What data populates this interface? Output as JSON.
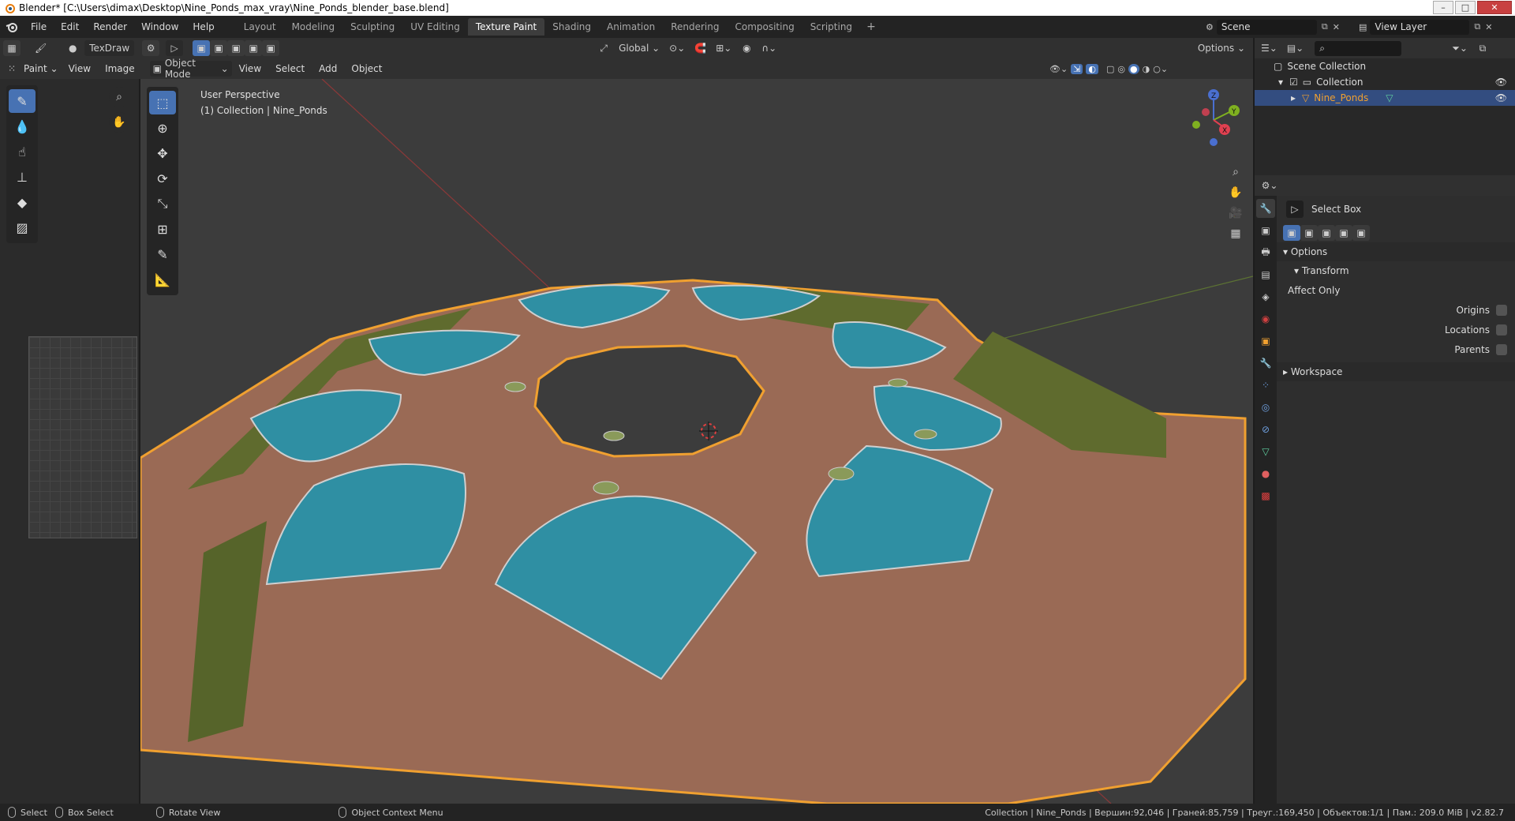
{
  "window": {
    "title": "Blender* [C:\\Users\\dimax\\Desktop\\Nine_Ponds_max_vray\\Nine_Ponds_blender_base.blend]",
    "controls": [
      "–",
      "□",
      "✕"
    ]
  },
  "menu": [
    "File",
    "Edit",
    "Render",
    "Window",
    "Help"
  ],
  "workspaces": {
    "tabs": [
      "Layout",
      "Modeling",
      "Sculpting",
      "UV Editing",
      "Texture Paint",
      "Shading",
      "Animation",
      "Rendering",
      "Compositing",
      "Scripting"
    ],
    "active": "Texture Paint",
    "add_icon": "+"
  },
  "scene": {
    "name": "Scene"
  },
  "view_layer": {
    "name": "View Layer"
  },
  "tool_header": {
    "brush_name": "TexDraw",
    "orientation": "Global",
    "options": "Options"
  },
  "image_editor": {
    "mode": "Paint",
    "menus": [
      "View",
      "Image"
    ],
    "tools": [
      "brush-icon",
      "drop-icon",
      "smear-icon",
      "clone-icon",
      "fill-icon",
      "mask-icon"
    ]
  },
  "viewport": {
    "mode": "Object Mode",
    "menus": [
      "View",
      "Select",
      "Add",
      "Object"
    ],
    "perspective": "User Perspective",
    "context": "(1) Collection | Nine_Ponds",
    "gizmo": {
      "z": "Z",
      "y": "Y",
      "x": "X"
    },
    "colors": {
      "background": "#3c3c3c",
      "ground": "#9a6a55",
      "water": "#2f8fa3",
      "grass": "#5f6b2e",
      "selection": "#f0a030"
    }
  },
  "outliner": {
    "root": "Scene Collection",
    "collection": "Collection",
    "object": "Nine_Ponds"
  },
  "properties": {
    "tool_name": "Select Box",
    "options_panel": "Options",
    "transform_panel": "Transform",
    "affect_only": "Affect Only",
    "checkboxes": [
      "Origins",
      "Locations",
      "Parents"
    ],
    "workspace_panel": "Workspace"
  },
  "statusbar": {
    "select": "Select",
    "box_select": "Box Select",
    "rotate_view": "Rotate View",
    "context_menu": "Object Context Menu",
    "stats": "Collection | Nine_Ponds | Вершин:92,046 | Граней:85,759 | Треуг.:169,450 | Объектов:1/1 | Пам.: 209.0 MiB | v2.82.7"
  }
}
